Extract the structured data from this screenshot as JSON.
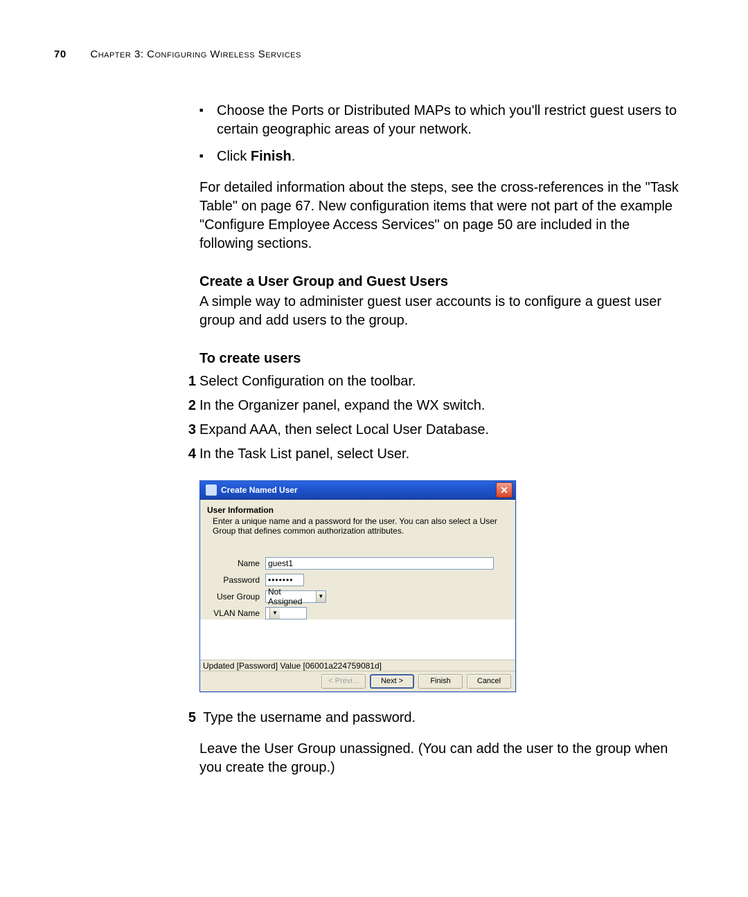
{
  "page": {
    "number": "70",
    "chapter_smallcaps": "Chapter 3: Configuring Wireless Services"
  },
  "bullets": {
    "b1": "Choose the Ports or Distributed MAPs to which you'll restrict guest users to certain geographic areas of your network.",
    "b2_pre": "Click ",
    "b2_bold": "Finish",
    "b2_post": "."
  },
  "para1": "For detailed information about the steps, see the cross-references in the \"Task Table\" on page 67. New configuration items that were not part of the example \"Configure Employee Access Services\" on page 50 are included in the following sections.",
  "h_create": "Create a User Group and Guest Users",
  "para2": "A simple way to administer guest user accounts is to configure a guest user group and add users to the group.",
  "h_tocreate": "To create users",
  "steps": {
    "s1": "Select Configuration on the toolbar.",
    "s2": "In the Organizer panel, expand the WX switch.",
    "s3": "Expand AAA, then select Local User Database.",
    "s4": "In the Task List panel, select User.",
    "s5": "Type the username and password.",
    "s5b": "Leave the User Group unassigned. (You can add the user to the group when you create the group.)"
  },
  "dialog": {
    "title": "Create Named User",
    "section_title": "User Information",
    "section_desc": "Enter a unique name and a password for the user. You can also select a User Group that defines common authorization attributes.",
    "labels": {
      "name": "Name",
      "password": "Password",
      "usergroup": "User Group",
      "vlanname": "VLAN Name"
    },
    "values": {
      "name": "guest1",
      "password": "•••••••",
      "usergroup": "Not Assigned",
      "vlanname": ""
    },
    "status": "Updated [Password] Value [06001a224759081d]",
    "buttons": {
      "prev": "< Previ...",
      "next": "Next >",
      "finish": "Finish",
      "cancel": "Cancel"
    }
  }
}
